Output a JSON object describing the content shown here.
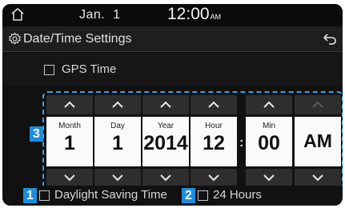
{
  "status_bar": {
    "date": "Jan.  1",
    "time": "12:00",
    "ampm": "AM"
  },
  "header": {
    "title": "Date/Time Settings"
  },
  "gps": {
    "label": "GPS Time",
    "checked": false
  },
  "picker": {
    "columns": [
      {
        "id": "month",
        "label": "Month",
        "value": "1"
      },
      {
        "id": "day",
        "label": "Day",
        "value": "1"
      },
      {
        "id": "year",
        "label": "Year",
        "value": "2014"
      },
      {
        "id": "hour",
        "label": "Hour",
        "value": "12"
      },
      {
        "id": "min",
        "label": "Min",
        "value": "00"
      },
      {
        "id": "ampm",
        "label": "",
        "value": "AM"
      }
    ],
    "separator": ":"
  },
  "options": {
    "daylight_saving": {
      "label": "Daylight Saving Time",
      "checked": false
    },
    "hours_24": {
      "label": "24 Hours",
      "checked": false
    }
  },
  "badges": {
    "b1": "1",
    "b2": "2",
    "b3": "3"
  },
  "colors": {
    "accent_blue": "#1a8ede",
    "dashed_border": "#3aa0e8",
    "screen_bg": "#111111"
  },
  "icons": {
    "home": "home-icon",
    "settings": "gear-icon",
    "back": "back-arrow-icon",
    "up": "chevron-up-icon",
    "down": "chevron-down-icon"
  }
}
